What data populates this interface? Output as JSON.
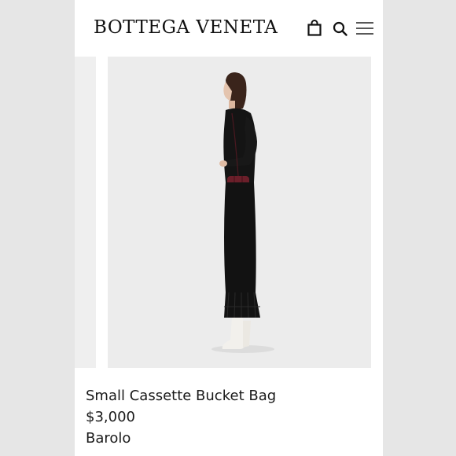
{
  "header": {
    "logo": "BOTTEGA VENETA",
    "icons": [
      "shopping-bag-icon",
      "search-icon",
      "hamburger-menu-icon"
    ]
  },
  "product": {
    "name": "Small Cassette Bucket Bag",
    "price": "$3,000",
    "color": "Barolo"
  },
  "colors": {
    "bag": "#6b1f2a",
    "dress": "#141414",
    "boots": "#f2f0ec",
    "photo_background": "#ececec"
  }
}
